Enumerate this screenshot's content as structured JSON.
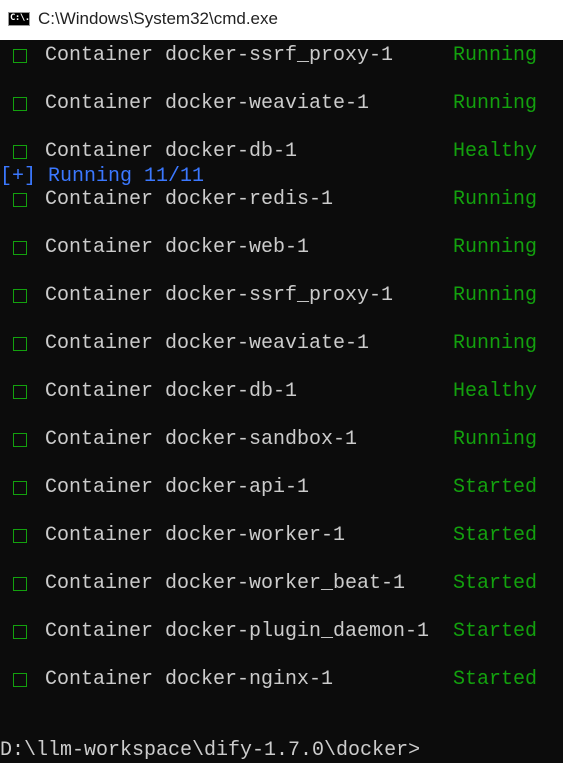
{
  "window": {
    "title": "C:\\Windows\\System32\\cmd.exe",
    "icon_text": "C:\\."
  },
  "console": {
    "rows": [
      {
        "container": "Container docker-ssrf_proxy-1",
        "status": "Running"
      },
      {
        "container": "Container docker-weaviate-1",
        "status": "Running"
      },
      {
        "container": "Container docker-db-1",
        "status": "Healthy"
      },
      {
        "container": "Container docker-redis-1",
        "status": "Running"
      },
      {
        "container": "Container docker-web-1",
        "status": "Running"
      },
      {
        "container": "Container docker-ssrf_proxy-1",
        "status": "Running"
      },
      {
        "container": "Container docker-weaviate-1",
        "status": "Running"
      },
      {
        "container": "Container docker-db-1",
        "status": "Healthy"
      },
      {
        "container": "Container docker-sandbox-1",
        "status": "Running"
      },
      {
        "container": "Container docker-api-1",
        "status": "Started"
      },
      {
        "container": "Container docker-worker-1",
        "status": "Started"
      },
      {
        "container": "Container docker-worker_beat-1",
        "status": "Started"
      },
      {
        "container": "Container docker-plugin_daemon-1",
        "status": "Started"
      },
      {
        "container": "Container docker-nginx-1",
        "status": "Started"
      }
    ],
    "progress_line": "[+] Running 11/11",
    "prompt": "D:\\llm-workspace\\dify-1.7.0\\docker>"
  },
  "colors": {
    "background": "#0c0c0c",
    "text": "#cccccc",
    "status_green": "#13a10e",
    "progress_blue": "#3b78ff"
  },
  "icons": {
    "app_icon": "cmd-console-icon",
    "row_icon": "checkbox-icon"
  }
}
